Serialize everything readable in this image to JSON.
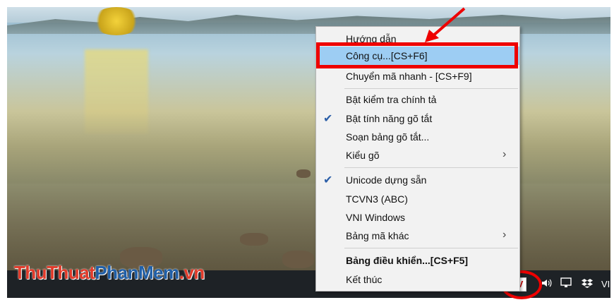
{
  "watermark": {
    "part1": "ThuThuat",
    "part2": "PhanMem",
    "part3": ".vn"
  },
  "menu": {
    "items": [
      {
        "label": "Hướng dẫn",
        "checked": false,
        "submenu": false,
        "bold": false
      },
      {
        "label": "Công cụ...[CS+F6]",
        "checked": false,
        "submenu": false,
        "bold": false,
        "highlighted": true
      },
      {
        "label": "Chuyển mã nhanh - [CS+F9]",
        "checked": false,
        "submenu": false,
        "bold": false
      },
      {
        "label": "Bật kiểm tra chính tả",
        "checked": false,
        "submenu": false,
        "bold": false
      },
      {
        "label": "Bật tính năng gõ tắt",
        "checked": true,
        "submenu": false,
        "bold": false
      },
      {
        "label": "Soạn bảng gõ tắt...",
        "checked": false,
        "submenu": false,
        "bold": false
      },
      {
        "label": "Kiểu gõ",
        "checked": false,
        "submenu": true,
        "bold": false
      },
      {
        "label": "Unicode dựng sẵn",
        "checked": true,
        "submenu": false,
        "bold": false
      },
      {
        "label": "TCVN3 (ABC)",
        "checked": false,
        "submenu": false,
        "bold": false
      },
      {
        "label": "VNI Windows",
        "checked": false,
        "submenu": false,
        "bold": false
      },
      {
        "label": "Bảng mã khác",
        "checked": false,
        "submenu": true,
        "bold": false
      },
      {
        "label": "Bảng điều khiển...[CS+F5]",
        "checked": false,
        "submenu": false,
        "bold": true
      },
      {
        "label": "Kết thúc",
        "checked": false,
        "submenu": false,
        "bold": false
      }
    ],
    "check_glyph": "✔",
    "submenu_glyph": "›"
  },
  "taskbar": {
    "tray_icon_label": "V",
    "volume_icon": "volume-icon",
    "network_icon": "network-icon",
    "dropbox_icon": "dropbox-icon",
    "language": "VIE"
  },
  "colors": {
    "highlight": "#9dcdf3",
    "annotation": "#e00000",
    "taskbar": "#1e2226"
  }
}
